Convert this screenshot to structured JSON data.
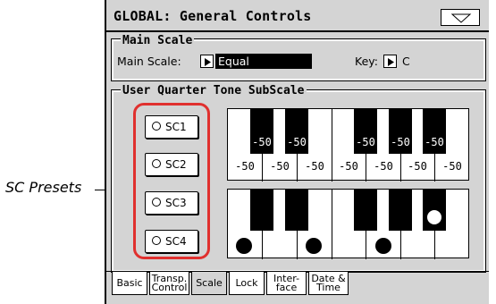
{
  "window": {
    "title": "GLOBAL: General Controls",
    "menu_icon": "triangle-down-icon"
  },
  "main_scale": {
    "section_label": "Main Scale",
    "scale_label": "Main Scale:",
    "scale_value": "Equal",
    "key_label": "Key:",
    "key_value": "C"
  },
  "subscale": {
    "section_label": "User Quarter Tone SubScale",
    "presets": [
      "SC1",
      "SC2",
      "SC3",
      "SC4"
    ],
    "black_key_values": [
      "-50",
      "-50",
      "-50",
      "-50",
      "-50"
    ],
    "white_key_values": [
      "-50",
      "-50",
      "-50",
      "-50",
      "-50",
      "-50",
      "-50"
    ]
  },
  "tabs": [
    {
      "label": "Basic"
    },
    {
      "label": "Transp.\nControl"
    },
    {
      "label": "Scale"
    },
    {
      "label": "Lock"
    },
    {
      "label": "Inter-\nface"
    },
    {
      "label": "Date &\nTime"
    }
  ],
  "active_tab": "Scale",
  "callout": {
    "label": "SC Presets"
  },
  "colors": {
    "highlight": "#e0302e",
    "panel": "#d4d4d4"
  }
}
